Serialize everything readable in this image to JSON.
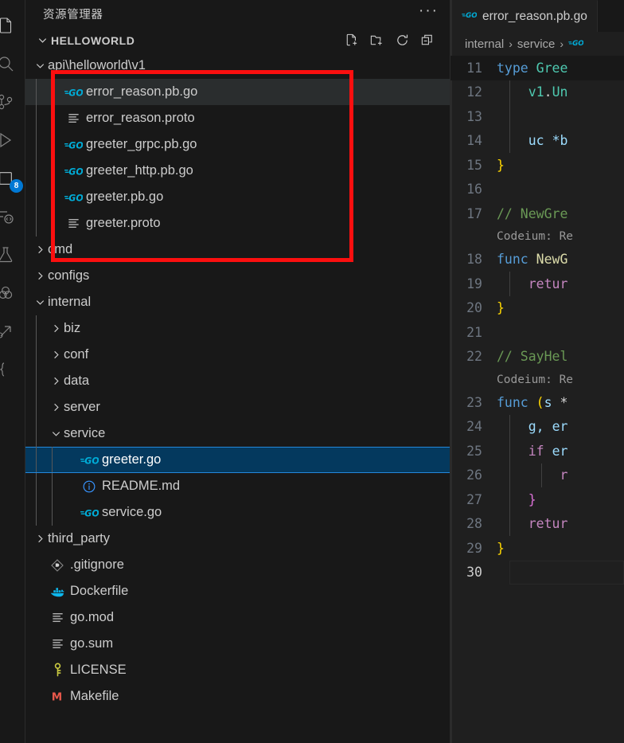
{
  "activity_bar": {
    "items": [
      {
        "name": "explorer-icon",
        "badge": ""
      },
      {
        "name": "search-icon",
        "badge": ""
      },
      {
        "name": "source-control-icon",
        "badge": ""
      },
      {
        "name": "run-and-debug-icon",
        "badge": ""
      },
      {
        "name": "extensions-icon",
        "badge": "8"
      },
      {
        "name": "remote-explorer-icon",
        "badge": ""
      },
      {
        "name": "testing-flask-icon",
        "badge": ""
      },
      {
        "name": "codeium-icon",
        "badge": ""
      },
      {
        "name": "share-icon",
        "badge": ""
      },
      {
        "name": "snippets-icon",
        "badge": ""
      }
    ]
  },
  "sidebar": {
    "title": "资源管理器",
    "more_actions": "···",
    "section_title": "HELLOWORLD",
    "actions": [
      {
        "label": "新建文件",
        "icon": "new-file-icon"
      },
      {
        "label": "新建文件夹",
        "icon": "new-folder-icon"
      },
      {
        "label": "刷新",
        "icon": "refresh-icon"
      },
      {
        "label": "全部折叠",
        "icon": "collapse-all-icon"
      }
    ],
    "tree": [
      {
        "label": "api\\helloworld\\v1",
        "type": "folder",
        "depth": 0,
        "expanded": true,
        "icon": "chevron-down-icon"
      },
      {
        "label": "error_reason.pb.go",
        "type": "file",
        "depth": 1,
        "icon": "go-file-icon",
        "state": "hovered"
      },
      {
        "label": "error_reason.proto",
        "type": "file",
        "depth": 1,
        "icon": "proto-file-icon"
      },
      {
        "label": "greeter_grpc.pb.go",
        "type": "file",
        "depth": 1,
        "icon": "go-file-icon"
      },
      {
        "label": "greeter_http.pb.go",
        "type": "file",
        "depth": 1,
        "icon": "go-file-icon"
      },
      {
        "label": "greeter.pb.go",
        "type": "file",
        "depth": 1,
        "icon": "go-file-icon"
      },
      {
        "label": "greeter.proto",
        "type": "file",
        "depth": 1,
        "icon": "proto-file-icon"
      },
      {
        "label": "cmd",
        "type": "folder",
        "depth": 0,
        "expanded": false,
        "icon": "chevron-right-icon"
      },
      {
        "label": "configs",
        "type": "folder",
        "depth": 0,
        "expanded": false,
        "icon": "chevron-right-icon"
      },
      {
        "label": "internal",
        "type": "folder",
        "depth": 0,
        "expanded": true,
        "icon": "chevron-down-icon"
      },
      {
        "label": "biz",
        "type": "folder",
        "depth": 1,
        "expanded": false,
        "icon": "chevron-right-icon"
      },
      {
        "label": "conf",
        "type": "folder",
        "depth": 1,
        "expanded": false,
        "icon": "chevron-right-icon"
      },
      {
        "label": "data",
        "type": "folder",
        "depth": 1,
        "expanded": false,
        "icon": "chevron-right-icon"
      },
      {
        "label": "server",
        "type": "folder",
        "depth": 1,
        "expanded": false,
        "icon": "chevron-right-icon"
      },
      {
        "label": "service",
        "type": "folder",
        "depth": 1,
        "expanded": true,
        "icon": "chevron-down-icon"
      },
      {
        "label": "greeter.go",
        "type": "file",
        "depth": 2,
        "icon": "go-file-icon",
        "state": "selected"
      },
      {
        "label": "README.md",
        "type": "file",
        "depth": 2,
        "icon": "markdown-info-icon"
      },
      {
        "label": "service.go",
        "type": "file",
        "depth": 2,
        "icon": "go-file-icon"
      },
      {
        "label": "third_party",
        "type": "folder",
        "depth": 0,
        "expanded": false,
        "icon": "chevron-right-icon"
      },
      {
        "label": ".gitignore",
        "type": "file",
        "depth": 0,
        "icon": "git-icon"
      },
      {
        "label": "Dockerfile",
        "type": "file",
        "depth": 0,
        "icon": "docker-icon"
      },
      {
        "label": "go.mod",
        "type": "file",
        "depth": 0,
        "icon": "proto-file-icon"
      },
      {
        "label": "go.sum",
        "type": "file",
        "depth": 0,
        "icon": "proto-file-icon"
      },
      {
        "label": "LICENSE",
        "type": "file",
        "depth": 0,
        "icon": "key-icon"
      },
      {
        "label": "Makefile",
        "type": "file",
        "depth": 0,
        "icon": "makefile-icon"
      }
    ]
  },
  "editor": {
    "tab": {
      "label": "error_reason.pb.go",
      "icon": "go-file-icon"
    },
    "breadcrumb": [
      "internal",
      "service"
    ],
    "lines": [
      {
        "num": "11",
        "sticky": true,
        "tokens": [
          {
            "t": "type ",
            "c": "t-kw"
          },
          {
            "t": "Gree",
            "c": "t-type"
          }
        ]
      },
      {
        "num": "12",
        "indent": 1,
        "tokens": [
          {
            "t": "    ",
            "c": "t-pl"
          },
          {
            "t": "v1",
            "c": "t-type"
          },
          {
            "t": ".",
            "c": "t-pl"
          },
          {
            "t": "Un",
            "c": "t-type"
          }
        ]
      },
      {
        "num": "13",
        "indent": 1,
        "tokens": []
      },
      {
        "num": "14",
        "indent": 1,
        "tokens": [
          {
            "t": "    ",
            "c": "t-pl"
          },
          {
            "t": "uc ",
            "c": "t-var"
          },
          {
            "t": "*b",
            "c": "t-var"
          }
        ]
      },
      {
        "num": "15",
        "tokens": [
          {
            "t": "}",
            "c": "t-brc-y"
          }
        ]
      },
      {
        "num": "16",
        "tokens": []
      },
      {
        "num": "17",
        "tokens": [
          {
            "t": "// NewGre",
            "c": "t-cmt"
          }
        ]
      },
      {
        "num": "18",
        "codelens": "Codeium: Re",
        "tokens": [
          {
            "t": "func ",
            "c": "t-kw"
          },
          {
            "t": "NewG",
            "c": "t-fn"
          }
        ]
      },
      {
        "num": "19",
        "indent": 1,
        "tokens": [
          {
            "t": "    ",
            "c": "t-pl"
          },
          {
            "t": "retur",
            "c": "t-ret"
          }
        ]
      },
      {
        "num": "20",
        "tokens": [
          {
            "t": "}",
            "c": "t-brc-y"
          }
        ]
      },
      {
        "num": "21",
        "tokens": []
      },
      {
        "num": "22",
        "tokens": [
          {
            "t": "// SayHel",
            "c": "t-cmt"
          }
        ]
      },
      {
        "num": "23",
        "codelens": "Codeium: Re",
        "tokens": [
          {
            "t": "func ",
            "c": "t-kw"
          },
          {
            "t": "(",
            "c": "t-brc-y"
          },
          {
            "t": "s ",
            "c": "t-var"
          },
          {
            "t": "*",
            "c": "t-pl"
          }
        ]
      },
      {
        "num": "24",
        "indent": 1,
        "tokens": [
          {
            "t": "    ",
            "c": "t-pl"
          },
          {
            "t": "g, ",
            "c": "t-var"
          },
          {
            "t": "er",
            "c": "t-var"
          }
        ]
      },
      {
        "num": "25",
        "indent": 1,
        "tokens": [
          {
            "t": "    ",
            "c": "t-pl"
          },
          {
            "t": "if ",
            "c": "t-ret"
          },
          {
            "t": "er",
            "c": "t-var"
          }
        ]
      },
      {
        "num": "26",
        "indent": 2,
        "tokens": [
          {
            "t": "        ",
            "c": "t-pl"
          },
          {
            "t": "r",
            "c": "t-ret"
          }
        ]
      },
      {
        "num": "27",
        "indent": 1,
        "tokens": [
          {
            "t": "    ",
            "c": "t-pl"
          },
          {
            "t": "}",
            "c": "t-brc-p"
          }
        ]
      },
      {
        "num": "28",
        "indent": 1,
        "tokens": [
          {
            "t": "    ",
            "c": "t-pl"
          },
          {
            "t": "retur",
            "c": "t-ret"
          }
        ]
      },
      {
        "num": "29",
        "tokens": [
          {
            "t": "}",
            "c": "t-brc-y"
          }
        ]
      },
      {
        "num": "30",
        "active": true,
        "tokens": []
      }
    ]
  },
  "annotation": {
    "shape": "rectangle",
    "color": "#fb0f0f",
    "target": "api\\helloworld\\v1 folder contents"
  }
}
